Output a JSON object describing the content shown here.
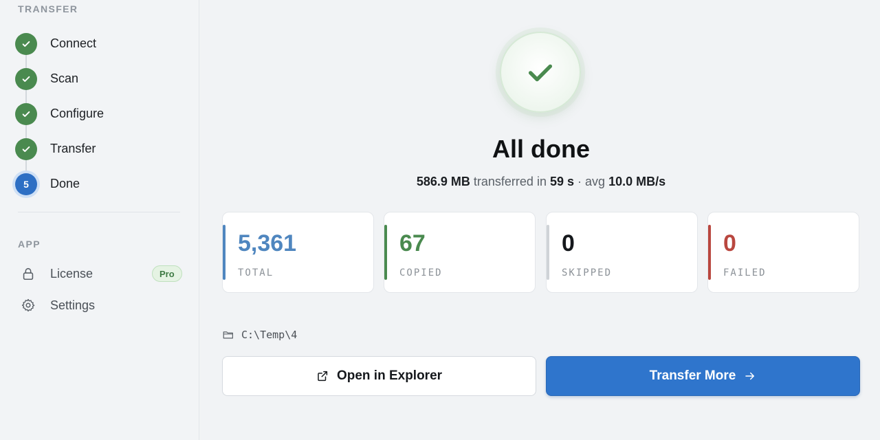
{
  "sidebar": {
    "transfer_section": "TRANSFER",
    "steps": [
      {
        "label": "Connect",
        "status": "done"
      },
      {
        "label": "Scan",
        "status": "done"
      },
      {
        "label": "Configure",
        "status": "done"
      },
      {
        "label": "Transfer",
        "status": "done"
      },
      {
        "label": "Done",
        "status": "active",
        "number": "5"
      }
    ],
    "app_section": "APP",
    "app_items": [
      {
        "label": "License",
        "icon": "lock-icon",
        "badge": "Pro"
      },
      {
        "label": "Settings",
        "icon": "gear-icon"
      }
    ]
  },
  "main": {
    "title": "All done",
    "summary": {
      "size": "586.9 MB",
      "text_transferred": "transferred in",
      "duration": "59 s",
      "text_avg": "· avg",
      "speed": "10.0 MB/s"
    },
    "stats": [
      {
        "value": "5,361",
        "label": "TOTAL",
        "color": "#4f86bf"
      },
      {
        "value": "67",
        "label": "COPIED",
        "color": "#4a8a4f"
      },
      {
        "value": "0",
        "label": "SKIPPED",
        "color": "#15181c"
      },
      {
        "value": "0",
        "label": "FAILED",
        "color": "#b9473f"
      }
    ],
    "path": "C:\\Temp\\4",
    "open_button": "Open in Explorer",
    "more_button": "Transfer More"
  },
  "colors": {
    "accent": "#2f75cc",
    "success": "#4a8a4f",
    "failed": "#b9473f",
    "skipped_accent": "#cfd3d7"
  }
}
